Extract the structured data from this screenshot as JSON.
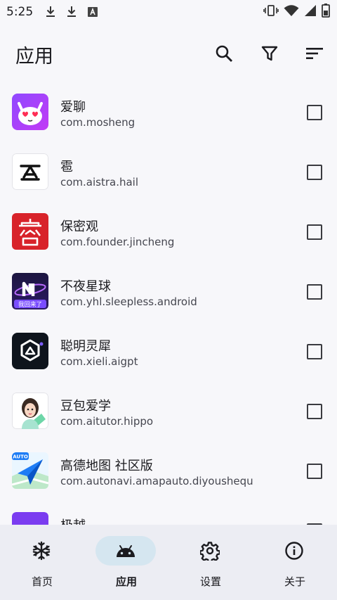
{
  "status_bar": {
    "time": "5:25",
    "icons_left": [
      "download-icon",
      "download-icon",
      "keyboard-a-icon"
    ],
    "icons_right": [
      "vibrate-icon",
      "wifi-icon",
      "signal-icon",
      "battery-icon"
    ]
  },
  "app_bar": {
    "title": "应用",
    "actions": [
      "search-icon",
      "filter-icon",
      "sort-icon"
    ]
  },
  "apps": [
    {
      "name": "爱聊",
      "package": "com.mosheng",
      "checked": false
    },
    {
      "name": "雹",
      "package": "com.aistra.hail",
      "checked": false
    },
    {
      "name": "保密观",
      "package": "com.founder.jincheng",
      "checked": false
    },
    {
      "name": "不夜星球",
      "package": "com.yhl.sleepless.android",
      "checked": false
    },
    {
      "name": "聪明灵犀",
      "package": "com.xieli.aigpt",
      "checked": false
    },
    {
      "name": "豆包爱学",
      "package": "com.aitutor.hippo",
      "checked": false
    },
    {
      "name": "高德地图 社区版",
      "package": "com.autonavi.amapauto.diyoushequ",
      "checked": false
    },
    {
      "name": "极越",
      "package": "",
      "checked": false
    }
  ],
  "app_icon_texts": {
    "sleepless": "我回来了",
    "amap": "AUTO"
  },
  "bottom_nav": [
    {
      "label": "首页",
      "icon": "snowflake-icon",
      "active": false
    },
    {
      "label": "应用",
      "icon": "android-icon",
      "active": true
    },
    {
      "label": "设置",
      "icon": "gear-icon",
      "active": false
    },
    {
      "label": "关于",
      "icon": "info-icon",
      "active": false
    }
  ],
  "colors": {
    "background": "#f7f7fa",
    "nav_background": "#ecedf3",
    "active_pill": "#d5e6f0"
  }
}
